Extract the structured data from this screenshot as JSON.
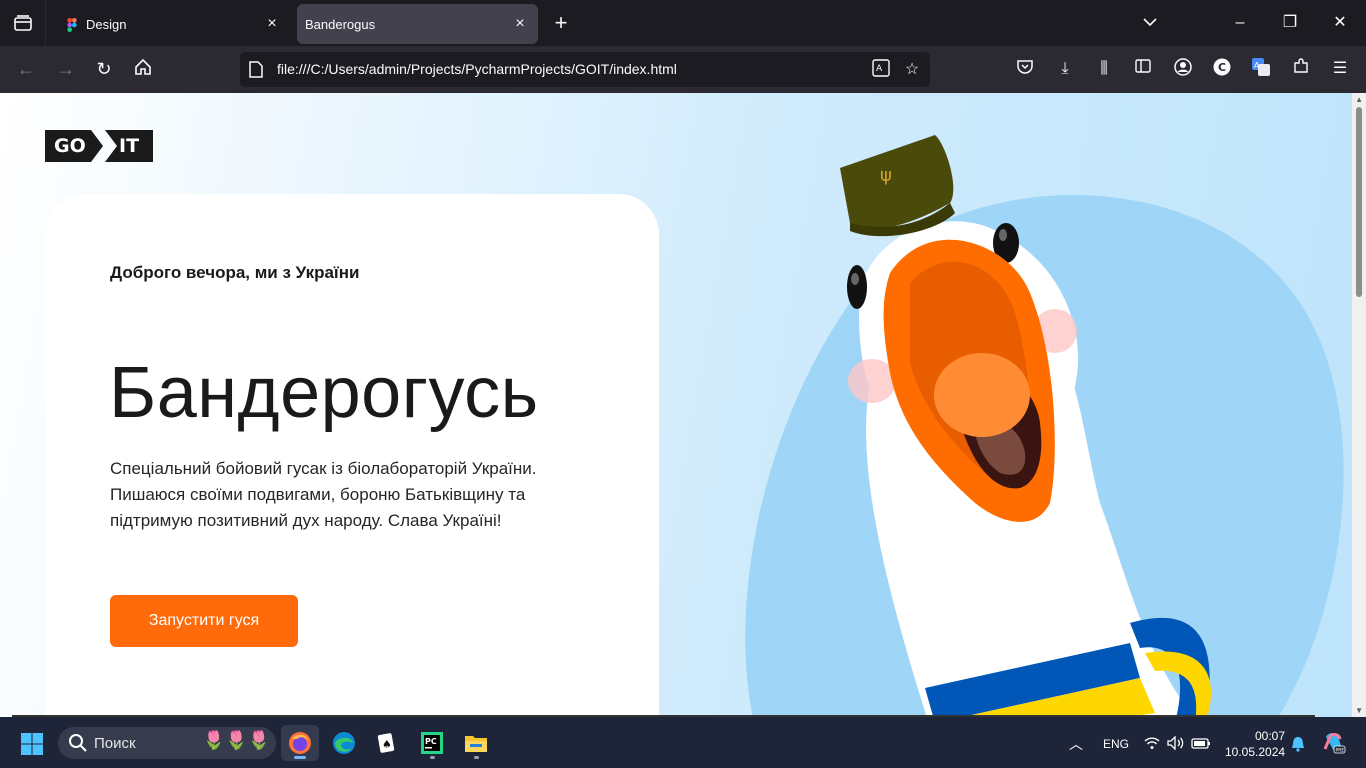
{
  "browser": {
    "tabs": [
      {
        "label": "Design",
        "active": false
      },
      {
        "label": "Banderogus",
        "active": true
      }
    ],
    "url": "file:///C:/Users/admin/Projects/PycharmProjects/GOIT/index.html"
  },
  "page": {
    "logo": {
      "left": "GO",
      "right": "IT"
    },
    "subtitle": "Доброго вечора, ми з України",
    "title": "Бандерогусь",
    "description": "Спеціальний бойовий гусак із біолабораторій України. Пишаюся своїми подвигами, бороню Батьківщину та підтримую позитивний дух народу. Слава Україні!",
    "cta_label": "Запустити гуся",
    "colors": {
      "accent": "#ff6b0a",
      "text": "#1a1a1a",
      "card": "#ffffff",
      "background_blue": "#bde4fb"
    }
  },
  "taskbar": {
    "search_placeholder": "Поиск",
    "language": "ENG",
    "time": "00:07",
    "date": "10.05.2024",
    "apps": [
      "firefox-icon",
      "edge-icon",
      "solitaire-icon",
      "pycharm-icon",
      "file-explorer-icon"
    ]
  }
}
